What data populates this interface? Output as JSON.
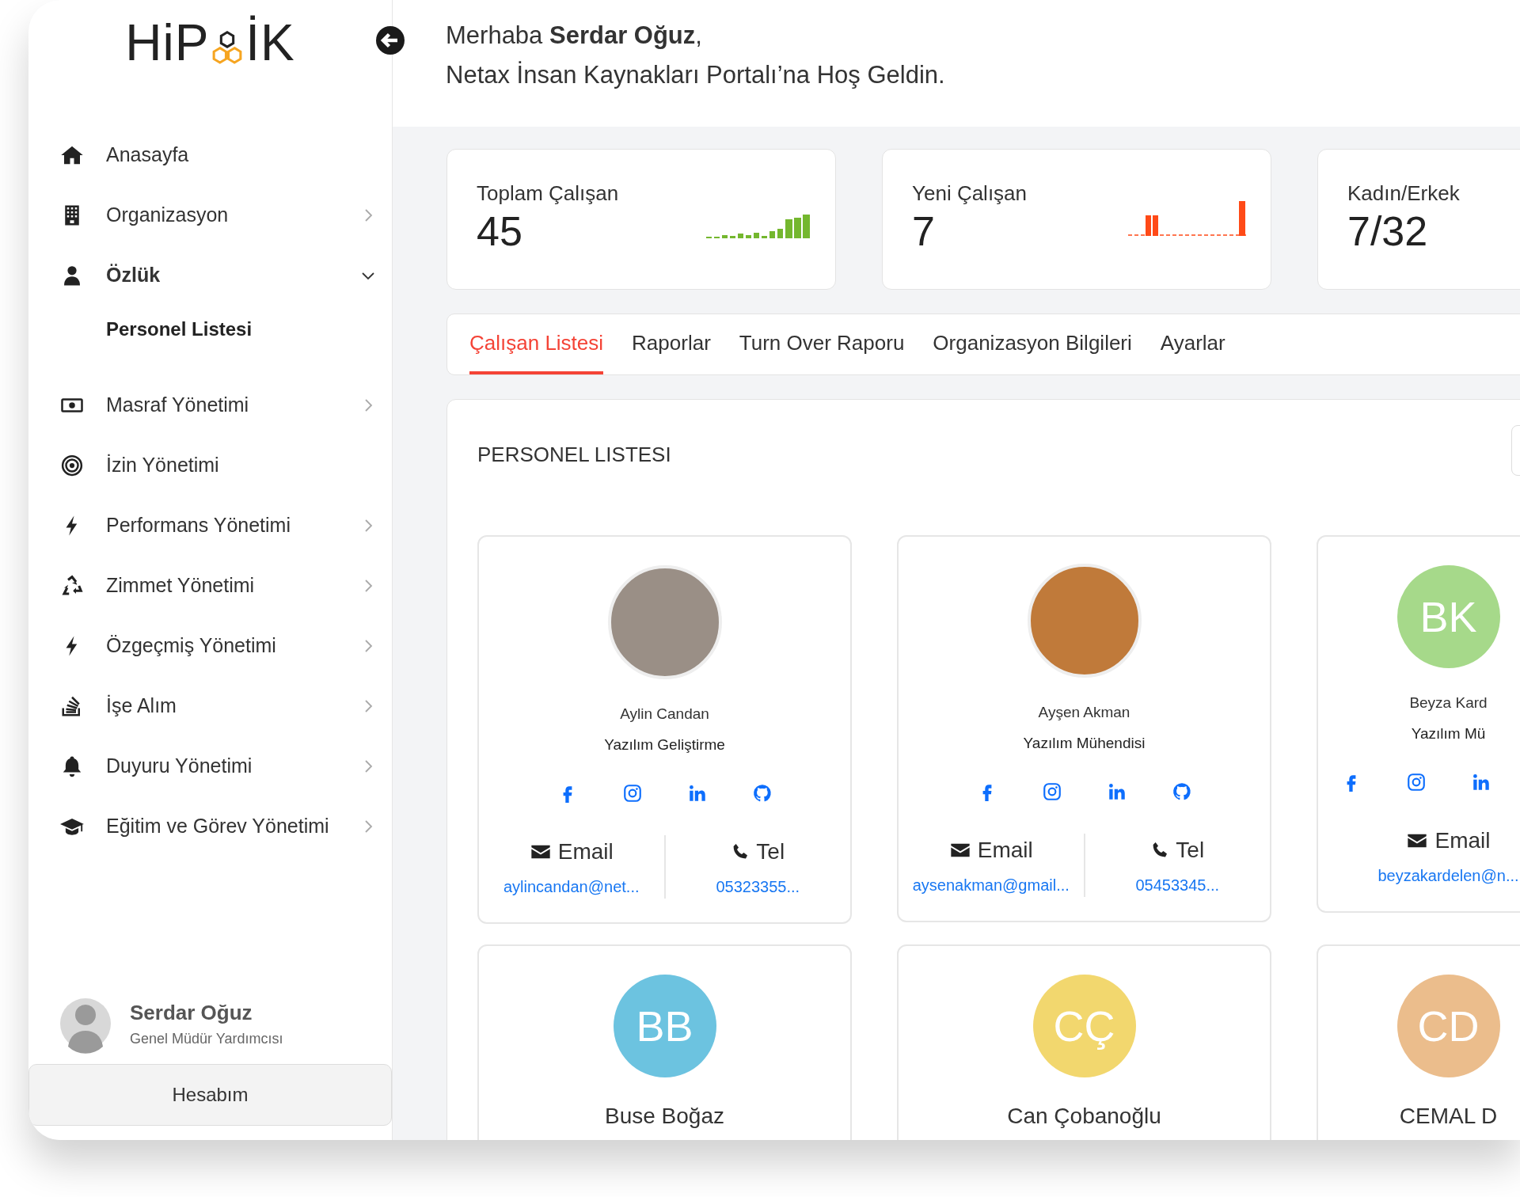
{
  "sidebar": {
    "logo": {
      "before": "HiP",
      "after": "İK"
    },
    "items": [
      {
        "label": "Anasayfa",
        "expandable": false,
        "expanded": false,
        "selected": false
      },
      {
        "label": "Organizasyon",
        "expandable": true,
        "expanded": false,
        "selected": false
      },
      {
        "label": "Özlük",
        "expandable": true,
        "expanded": true,
        "selected": false,
        "children": [
          {
            "label": "Personel Listesi",
            "selected": true
          }
        ]
      },
      {
        "label": "Masraf Yönetimi",
        "expandable": true,
        "expanded": false,
        "selected": false
      },
      {
        "label": "İzin Yönetimi",
        "expandable": false,
        "expanded": false,
        "selected": false
      },
      {
        "label": "Performans Yönetimi",
        "expandable": true,
        "expanded": false,
        "selected": false
      },
      {
        "label": "Zimmet Yönetimi",
        "expandable": true,
        "expanded": false,
        "selected": false
      },
      {
        "label": "Özgeçmiş Yönetimi",
        "expandable": true,
        "expanded": false,
        "selected": false
      },
      {
        "label": "İşe Alım",
        "expandable": true,
        "expanded": false,
        "selected": false
      },
      {
        "label": "Duyuru Yönetimi",
        "expandable": true,
        "expanded": false,
        "selected": false
      },
      {
        "label": "Eğitim ve Görev Yönetimi",
        "expandable": true,
        "expanded": false,
        "selected": false
      }
    ],
    "user": {
      "name": "Serdar Oğuz",
      "role": "Genel Müdür Yardımcısı"
    },
    "account_button": "Hesabım"
  },
  "header": {
    "greeting": "Merhaba **Serdar Oğuz**,",
    "welcome": "Netax İnsan Kaynakları Portalı’na Hoş Geldin."
  },
  "stats": [
    {
      "label": "Toplam Çalışan",
      "value": "45",
      "color": "#74b72e"
    },
    {
      "label": "Yeni Çalışan",
      "value": "7",
      "color": "#ff4a17"
    },
    {
      "label": "Kadın/Erkek",
      "value": "7/32"
    }
  ],
  "tabs": [
    {
      "label": "Çalışan Listesi",
      "selected": true
    },
    {
      "label": "Raporlar",
      "selected": false
    },
    {
      "label": "Turn Over Raporu",
      "selected": false
    },
    {
      "label": "Organizasyon Bilgileri",
      "selected": false
    },
    {
      "label": "Ayarlar",
      "selected": false
    }
  ],
  "panel": {
    "title": "PERSONEL LISTESI",
    "employees": [
      {
        "kind": "photo",
        "name": "Aylin Candan",
        "role": "Yazılım Geliştirme",
        "email_label": "Email",
        "email": "aylincandan@net...",
        "phone_label": "Tel",
        "phone": "05323355..."
      },
      {
        "kind": "photo",
        "name": "Ayşen Akman",
        "role": "Yazılım Mühendisi",
        "email_label": "Email",
        "email": "aysenakman@gmail...",
        "phone_label": "Tel",
        "phone": "05453345..."
      },
      {
        "kind": "initials",
        "initials": "BK",
        "color": "#a6d98a",
        "name": "Beyza Kard",
        "role": "Yazılım Mü",
        "email_label": "Email",
        "email": "beyzakardelen@n..."
      },
      {
        "kind": "initials",
        "initials": "BB",
        "color": "#6cc3e0",
        "name": "Buse Boğaz"
      },
      {
        "kind": "initials",
        "initials": "CÇ",
        "color": "#f2d76e",
        "name": "Can Çobanoğlu"
      },
      {
        "kind": "initials",
        "initials": "CD",
        "color": "#ebbd8c",
        "name": "CEMAL D"
      }
    ]
  }
}
